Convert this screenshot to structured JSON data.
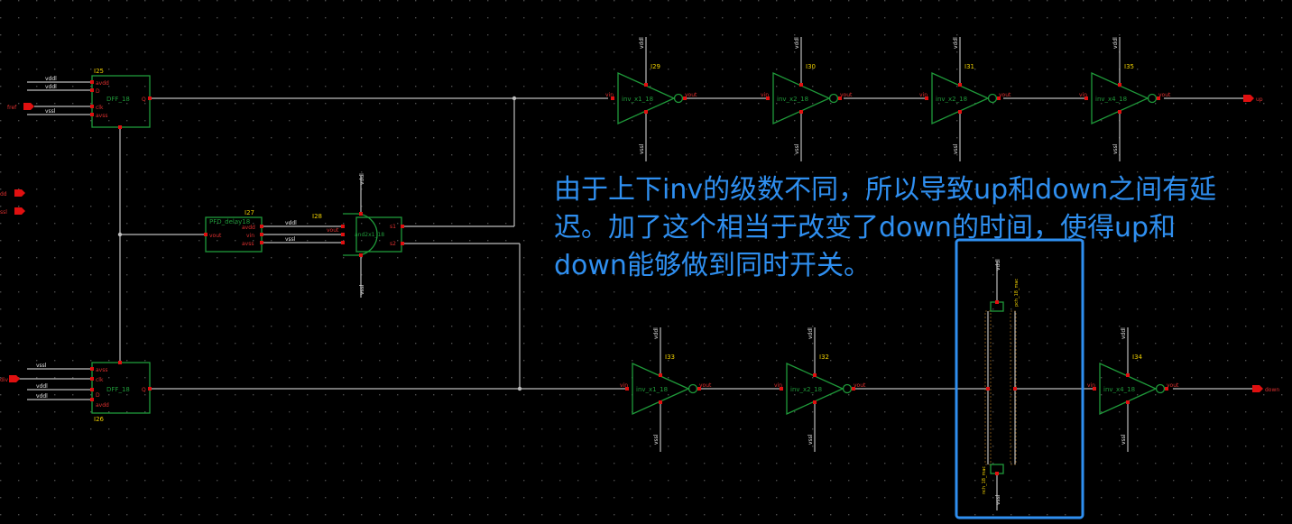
{
  "colors": {
    "background": "#000000",
    "grid_dot": "#4a4a4a",
    "wire": "#bdbdbd",
    "symbol": "#1f9a3a",
    "pin": "#e01010",
    "label": "#f0d000",
    "pin_text": "#e03030",
    "annotation_text": "#2f8ff0",
    "highlight_box": "#2f8ff0"
  },
  "annotation": {
    "line1": "由于上下inv的级数不同，所以导致up和down之间有延",
    "line2": "迟。加了这个相当于改变了down的时间，使得up和",
    "line3": "down能够做到同时开关。"
  },
  "ports": {
    "left": [
      "fref",
      "dd",
      "ssl",
      "div"
    ],
    "right": [
      "up",
      "down"
    ]
  },
  "instances": {
    "dff_top": {
      "name": "I25",
      "cell": "DFF_18",
      "pins": [
        "avdd",
        "D",
        "clk",
        "avss",
        "Q"
      ],
      "wires": [
        "vddl",
        "vddl",
        "vssl"
      ]
    },
    "dff_bot": {
      "name": "I26",
      "cell": "DFF_18",
      "pins": [
        "avss",
        "clk",
        "D",
        "avdd",
        "Q"
      ],
      "wires": [
        "vssl",
        "vddl",
        "vddl"
      ]
    },
    "delay": {
      "name": "I27",
      "cell": "PFD_delay18",
      "pins": [
        "vout",
        "avdd",
        "vin",
        "avss"
      ],
      "wires": [
        "vddl",
        "vssl"
      ]
    },
    "and2": {
      "name": "I28",
      "cell": "and2x1_18",
      "pins": [
        "vout",
        "s1",
        "s2"
      ],
      "rails": [
        "vddl",
        "vssl"
      ]
    },
    "inv_top": [
      {
        "name": "I29",
        "cell": "inv_x1_18"
      },
      {
        "name": "I30",
        "cell": "inv_x2_18"
      },
      {
        "name": "I31",
        "cell": "inv_x2_18"
      },
      {
        "name": "I35",
        "cell": "inv_x4_18"
      }
    ],
    "inv_bot": [
      {
        "name": "I33",
        "cell": "inv_x1_18"
      },
      {
        "name": "I32",
        "cell": "inv_x2_18"
      },
      {
        "name": "I34",
        "cell": "inv_x4_18"
      }
    ],
    "inv_pins": {
      "in": "vin",
      "out": "vout",
      "vdd": "vddl",
      "vss": "vssl"
    },
    "tgate": {
      "top_label": "pch_18_mac",
      "bottom_label": "nch_18_mac",
      "vdd": "vddl",
      "vss": "vssl"
    }
  }
}
